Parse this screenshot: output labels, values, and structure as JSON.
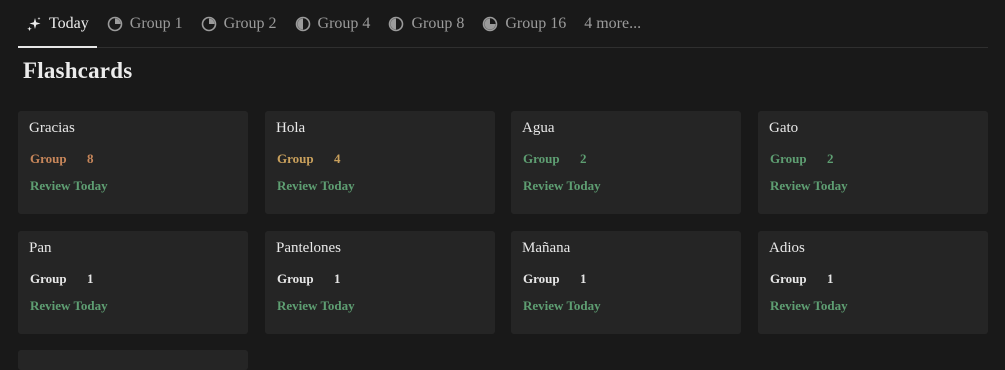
{
  "tabs": [
    {
      "label": "Today",
      "icon": "sparkles-icon",
      "active": true
    },
    {
      "label": "Group 1",
      "icon": "pie-quarter-icon"
    },
    {
      "label": "Group 2",
      "icon": "pie-quarter-icon"
    },
    {
      "label": "Group 4",
      "icon": "pie-half-icon"
    },
    {
      "label": "Group 8",
      "icon": "pie-half-icon"
    },
    {
      "label": "Group 16",
      "icon": "pie-three-quarter-icon"
    },
    {
      "label": "4 more..."
    }
  ],
  "page": {
    "title": "Flashcards"
  },
  "cards": [
    {
      "name": "Gracias",
      "group_label": "Group",
      "group_value": "8",
      "review": "Review Today",
      "group_color": "#c7865a"
    },
    {
      "name": "Hola",
      "group_label": "Group",
      "group_value": "4",
      "review": "Review Today",
      "group_color": "#c9a05c"
    },
    {
      "name": "Agua",
      "group_label": "Group",
      "group_value": "2",
      "review": "Review Today",
      "group_color": "#5e9e72"
    },
    {
      "name": "Gato",
      "group_label": "Group",
      "group_value": "2",
      "review": "Review Today",
      "group_color": "#5e9e72"
    },
    {
      "name": "Pan",
      "group_label": "Group",
      "group_value": "1",
      "review": "Review Today",
      "group_color": "#e6e6e6"
    },
    {
      "name": "Pantelones",
      "group_label": "Group",
      "group_value": "1",
      "review": "Review Today",
      "group_color": "#e6e6e6"
    },
    {
      "name": "Mañana",
      "group_label": "Group",
      "group_value": "1",
      "review": "Review Today",
      "group_color": "#e6e6e6"
    },
    {
      "name": "Adios",
      "group_label": "Group",
      "group_value": "1",
      "review": "Review Today",
      "group_color": "#e6e6e6"
    }
  ],
  "colors": {
    "background": "#191919",
    "card": "#252525",
    "review": "#5e9e72"
  }
}
